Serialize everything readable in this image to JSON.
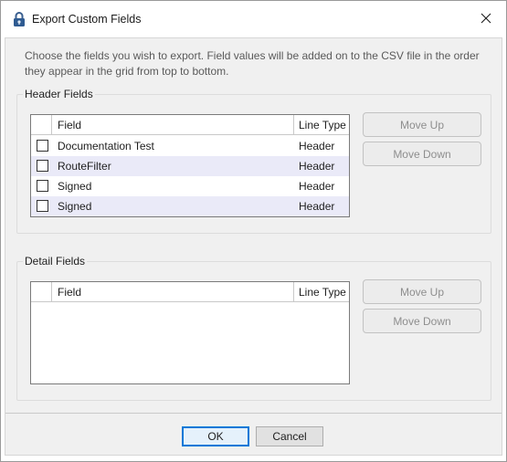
{
  "window": {
    "title": "Export Custom Fields",
    "icon": "lock-icon",
    "close_icon": "close-icon"
  },
  "description": "Choose the fields you wish to export. Field values will be added on to the CSV file in the order they appear in the grid from top to bottom.",
  "header_fields": {
    "label": "Header Fields",
    "columns": {
      "field": "Field",
      "line_type": "Line Type"
    },
    "rows": [
      {
        "field": "Documentation Test",
        "line_type": "Header",
        "checked": false
      },
      {
        "field": "RouteFilter",
        "line_type": "Header",
        "checked": false
      },
      {
        "field": "Signed",
        "line_type": "Header",
        "checked": false
      },
      {
        "field": "Signed",
        "line_type": "Header",
        "checked": false
      }
    ],
    "move_up": "Move Up",
    "move_down": "Move Down"
  },
  "detail_fields": {
    "label": "Detail Fields",
    "columns": {
      "field": "Field",
      "line_type": "Line Type"
    },
    "rows": [],
    "move_up": "Move Up",
    "move_down": "Move Down"
  },
  "footer": {
    "ok": "OK",
    "cancel": "Cancel"
  },
  "colors": {
    "accent": "#0078d7",
    "alt_row": "#eaeaf8",
    "disabled_text": "#8e8e8e"
  }
}
